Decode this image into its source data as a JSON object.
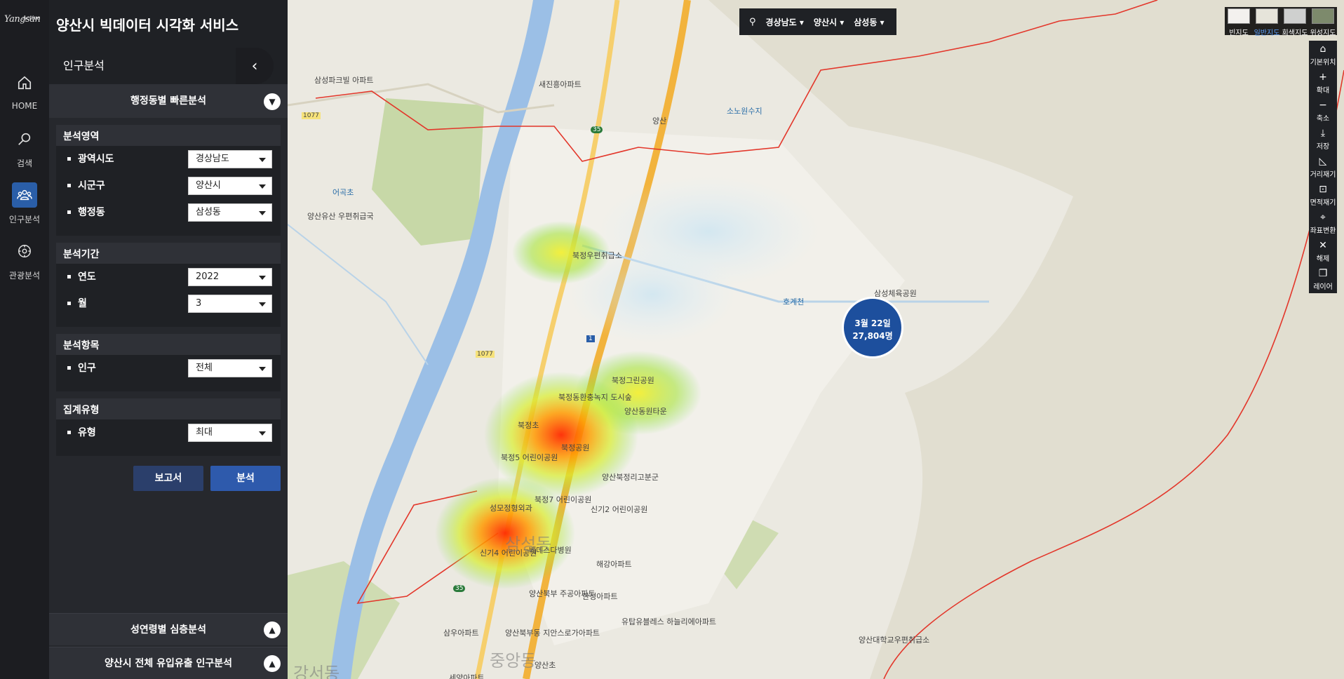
{
  "app": {
    "brand_script": "Yangsan",
    "brand_small": "Active",
    "title": "양산시 빅데이터 시각화 서비스"
  },
  "nav": {
    "items": [
      {
        "label": "HOME",
        "icon": "home-icon"
      },
      {
        "label": "검색",
        "icon": "search-icon"
      },
      {
        "label": "인구분석",
        "icon": "people-icon"
      },
      {
        "label": "관광분석",
        "icon": "tourism-icon"
      }
    ]
  },
  "panel": {
    "heading": "인구분석",
    "quick_title": "행정동별 빠른분석",
    "collapse_icon": "chevron-left-icon",
    "sections": [
      {
        "title": "분석영역",
        "rows": [
          {
            "label": "광역시도",
            "value": "경상남도"
          },
          {
            "label": "시군구",
            "value": "양산시"
          },
          {
            "label": "행정동",
            "value": "삼성동"
          }
        ]
      },
      {
        "title": "분석기간",
        "rows": [
          {
            "label": "연도",
            "value": "2022"
          },
          {
            "label": "월",
            "value": "3"
          }
        ]
      },
      {
        "title": "분석항목",
        "rows": [
          {
            "label": "인구",
            "value": "전체"
          }
        ]
      },
      {
        "title": "집계유형",
        "rows": [
          {
            "label": "유형",
            "value": "최대"
          }
        ]
      }
    ],
    "buttons": {
      "report": "보고서",
      "run": "분석"
    },
    "accordions": [
      "성연령별 심층분석",
      "양산시 전체 유입유출 인구분석"
    ]
  },
  "map": {
    "region_selector": [
      "경상남도",
      "양산시",
      "삼성동"
    ],
    "layers": [
      {
        "label": "빈지도",
        "active": false
      },
      {
        "label": "일반지도",
        "active": true
      },
      {
        "label": "회색지도",
        "active": false
      },
      {
        "label": "위성지도",
        "active": false
      }
    ],
    "tools": [
      {
        "label": "기본위치",
        "icon": "home-icon"
      },
      {
        "label": "확대",
        "icon": "plus-icon"
      },
      {
        "label": "축소",
        "icon": "minus-icon"
      },
      {
        "label": "저장",
        "icon": "download-icon"
      },
      {
        "label": "거리재기",
        "icon": "ruler-icon"
      },
      {
        "label": "면적재기",
        "icon": "area-icon"
      },
      {
        "label": "좌표변환",
        "icon": "coordinate-icon"
      },
      {
        "label": "해제",
        "icon": "close-icon"
      },
      {
        "label": "레이어",
        "icon": "layers-icon"
      }
    ],
    "cluster": {
      "date": "3월 22일",
      "count": "27,804명"
    },
    "labels": [
      "삼성파크빌 아파트",
      "새진흥아파트",
      "양산",
      "소노원수지",
      "어곡초",
      "양산유산 우편취급국",
      "북정우편취급소",
      "호계천",
      "삼성체육공원",
      "북정그린공원",
      "북정동환충녹지 도시숲",
      "양산동원타운",
      "북정초",
      "북정공원",
      "북정5 어린이공원",
      "양산북정리고분군",
      "북정7 어린이공원",
      "신기2 어린이공원",
      "성모정형외과",
      "신기4 어린이공원",
      "베데스다병원",
      "해강아파트",
      "양산북부 주공아파트",
      "한성아파트",
      "유탑유블레스 하늘리에아파트",
      "삼우아파트",
      "양산북부동 지안스로가아파트",
      "양산대학교우편취급소",
      "삼성동",
      "중앙동",
      "강서동",
      "양산초",
      "세양아파트"
    ],
    "road_numbers": [
      "1077",
      "1077",
      "35",
      "35",
      "1"
    ]
  },
  "colors": {
    "accent": "#2e5aac",
    "panel_bg": "#26282d",
    "rail_bg": "#1c1d21",
    "cluster": "#1d4f9d"
  }
}
